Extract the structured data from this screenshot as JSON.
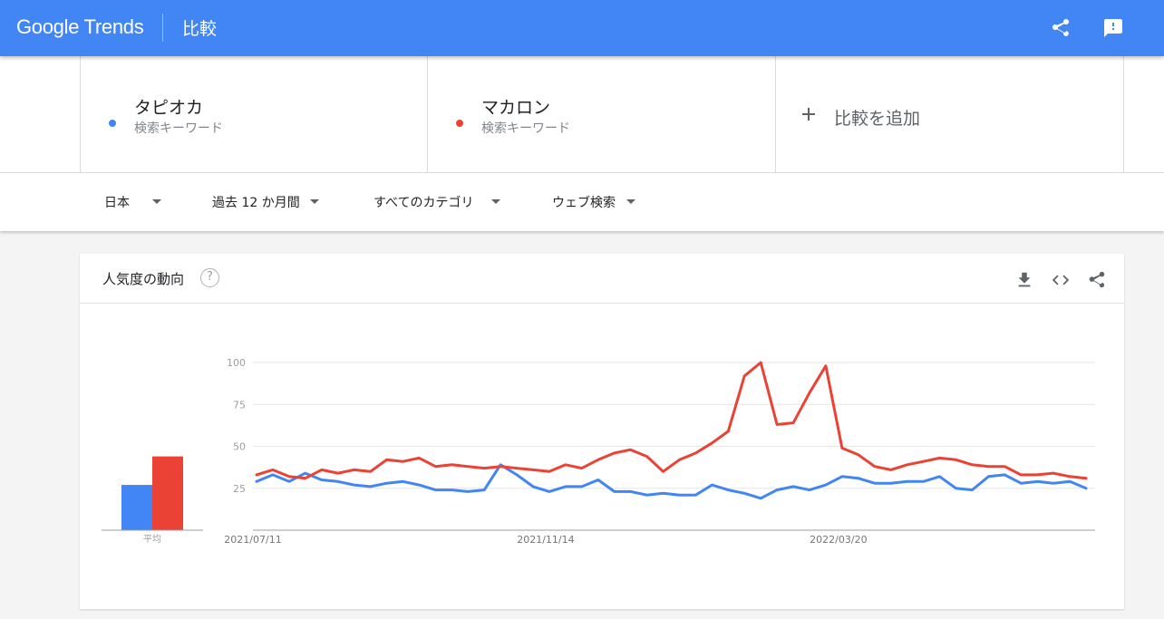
{
  "header": {
    "logo_text": "Google Trends",
    "page_title": "比較",
    "share_icon": "share-icon",
    "feedback_icon": "feedback-icon",
    "color": "#4285f4"
  },
  "terms": [
    {
      "name": "タピオカ",
      "sub": "検索キーワード",
      "color": "#4285f4"
    },
    {
      "name": "マカロン",
      "sub": "検索キーワード",
      "color": "#ea4335"
    }
  ],
  "add_compare": {
    "icon": "plus-icon",
    "label": "比較を追加"
  },
  "filters": [
    {
      "label": "日本"
    },
    {
      "label": "過去 12 か月間"
    },
    {
      "label": "すべてのカテゴリ"
    },
    {
      "label": "ウェブ検索"
    }
  ],
  "card": {
    "title": "人気度の動向",
    "help_icon": "help-icon",
    "icons": [
      "download-icon",
      "embed-icon",
      "share-icon"
    ],
    "help_glyph": "?"
  },
  "chart_data": {
    "type": "line",
    "title": "",
    "xlabel": "",
    "ylabel": "",
    "ylim": [
      0,
      100
    ],
    "yticks": [
      100,
      75,
      50,
      25
    ],
    "x_tick_labels": [
      {
        "label": "2021/07/11",
        "index": 0
      },
      {
        "label": "2021/11/14",
        "index": 18
      },
      {
        "label": "2022/03/20",
        "index": 36
      }
    ],
    "grid": true,
    "series": [
      {
        "name": "タピオカ",
        "color": "#4285f4",
        "values": [
          29,
          33,
          29,
          34,
          30,
          29,
          27,
          26,
          28,
          29,
          27,
          24,
          24,
          23,
          24,
          39,
          33,
          26,
          23,
          26,
          26,
          30,
          23,
          23,
          21,
          22,
          21,
          21,
          27,
          24,
          22,
          19,
          24,
          26,
          24,
          27,
          32,
          31,
          28,
          28,
          29,
          29,
          32,
          25,
          24,
          32,
          33,
          28,
          29,
          28,
          29,
          25
        ]
      },
      {
        "name": "マカロン",
        "color": "#ea4335",
        "values": [
          33,
          36,
          32,
          31,
          36,
          34,
          36,
          35,
          42,
          41,
          43,
          38,
          39,
          38,
          37,
          38,
          37,
          36,
          35,
          39,
          37,
          42,
          46,
          48,
          44,
          35,
          42,
          46,
          52,
          59,
          92,
          100,
          63,
          64,
          82,
          98,
          49,
          45,
          38,
          36,
          39,
          41,
          43,
          42,
          39,
          38,
          38,
          33,
          33,
          34,
          32,
          31
        ]
      }
    ],
    "average_bars": {
      "label": "平均",
      "values": [
        {
          "name": "タピオカ",
          "value": 27,
          "color": "#4285f4"
        },
        {
          "name": "マカロン",
          "value": 44,
          "color": "#ea4335"
        }
      ]
    }
  }
}
